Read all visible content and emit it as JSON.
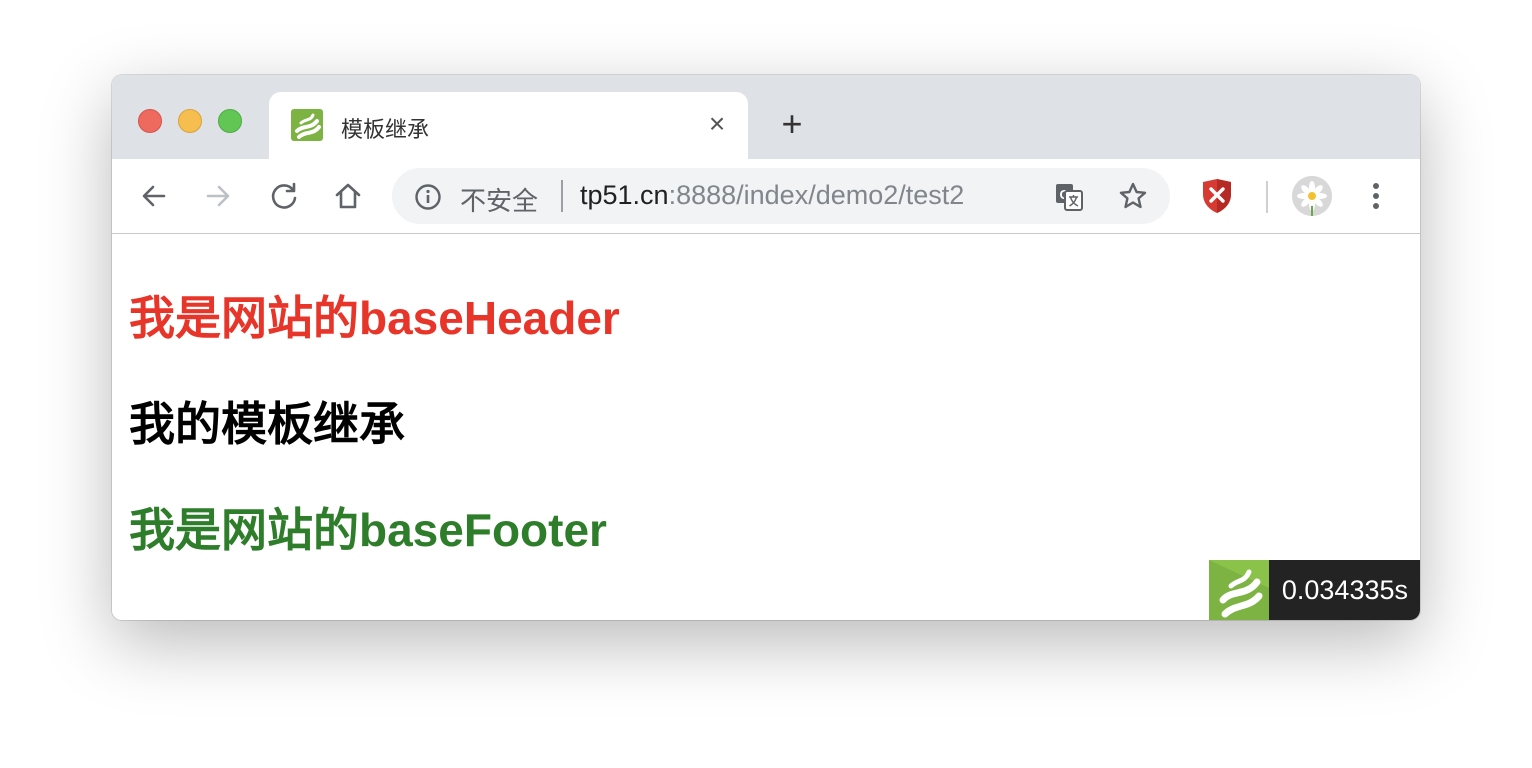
{
  "tab": {
    "title": "模板继承",
    "close": "×"
  },
  "new_tab": "+",
  "address_bar": {
    "security_label": "不安全",
    "host": "tp51.cn",
    "path": ":8888/index/demo2/test2"
  },
  "page": {
    "header_text": "我是网站的baseHeader",
    "main_text": "我的模板继承",
    "footer_text": "我是网站的baseFooter"
  },
  "trace": {
    "time": "0.034335s"
  },
  "colors": {
    "header": "#e8352a",
    "footer": "#2e7d2a",
    "brand_green": "#7cb342"
  },
  "icons": {
    "back": "back-arrow-icon",
    "forward": "forward-arrow-icon",
    "reload": "reload-icon",
    "home": "home-icon",
    "info": "info-icon",
    "translate": "translate-icon",
    "bookmark": "star-icon",
    "extension": "shield-icon",
    "profile": "avatar",
    "menu": "kebab-menu-icon"
  }
}
